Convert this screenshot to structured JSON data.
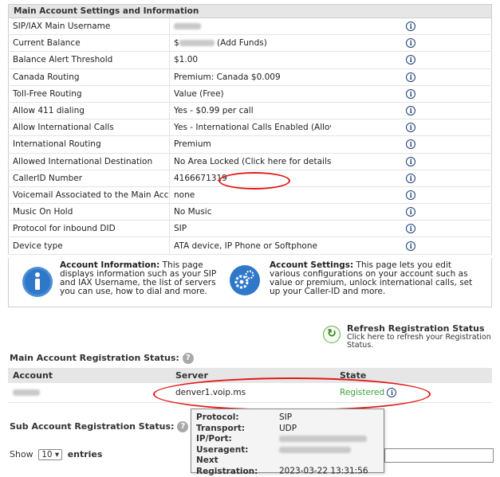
{
  "settings": {
    "title": "Main Account Settings and Information",
    "rows": [
      {
        "label": "SIP/IAX Main Username",
        "value": ""
      },
      {
        "label": "Current Balance",
        "value": "(Add Funds)"
      },
      {
        "label": "Balance Alert Threshold",
        "value": "$1.00"
      },
      {
        "label": "Canada Routing",
        "value": "Premium: Canada $0.009"
      },
      {
        "label": "Toll-Free Routing",
        "value": "Value (Free)"
      },
      {
        "label": "Allow 411 dialing",
        "value": "Yes - $0.99 per call"
      },
      {
        "label": "Allow International Calls",
        "value": "Yes - International Calls Enabled (Allowed destinations)"
      },
      {
        "label": "International Routing",
        "value": "Premium"
      },
      {
        "label": "Allowed International Destination",
        "value": "No Area Locked (Click here for details)"
      },
      {
        "label": "CallerID Number",
        "value": "4166671319"
      },
      {
        "label": "Voicemail Associated to the Main Account",
        "value": "none"
      },
      {
        "label": "Music On Hold",
        "value": "No Music"
      },
      {
        "label": "Protocol for inbound DID",
        "value": "SIP"
      },
      {
        "label": "Device type",
        "value": "ATA device, IP Phone or Softphone"
      }
    ],
    "balance_prefix": "$",
    "info_glyph": "i"
  },
  "help": {
    "account_info_title": "Account Information:",
    "account_info_text": " This page displays information such as your SIP and IAX Username, the list of servers you can use, how to dial and more.",
    "account_settings_title": "Account Settings:",
    "account_settings_text": " This page lets you edit various configurations on your account such as value or premium, unlock international calls, set up your Caller-ID and more."
  },
  "refresh": {
    "title": "Refresh Registration Status",
    "desc": "Click here to refresh your Registration Status."
  },
  "main_reg": {
    "label": "Main Account Registration Status:",
    "headers": [
      "Account",
      "Server",
      "State"
    ],
    "server": "denver1.voip.ms",
    "state": "Registered"
  },
  "tooltip": {
    "protocol_k": "Protocol:",
    "protocol_v": "SIP",
    "transport_k": "Transport:",
    "transport_v": "UDP",
    "ipport_k": "IP/Port:",
    "useragent_k": "Useragent:",
    "nextreg_k": "Next Registration:",
    "nextreg_v": "2023-03-22 13:31:56"
  },
  "sub_reg": {
    "label": "Sub Account Registration Status:"
  },
  "entries": {
    "show": "Show",
    "value": "10",
    "suffix": "entries"
  },
  "colors": {
    "highlight": "#e21818",
    "registered": "#3aa43a",
    "icon_blue": "#1c3f74"
  }
}
